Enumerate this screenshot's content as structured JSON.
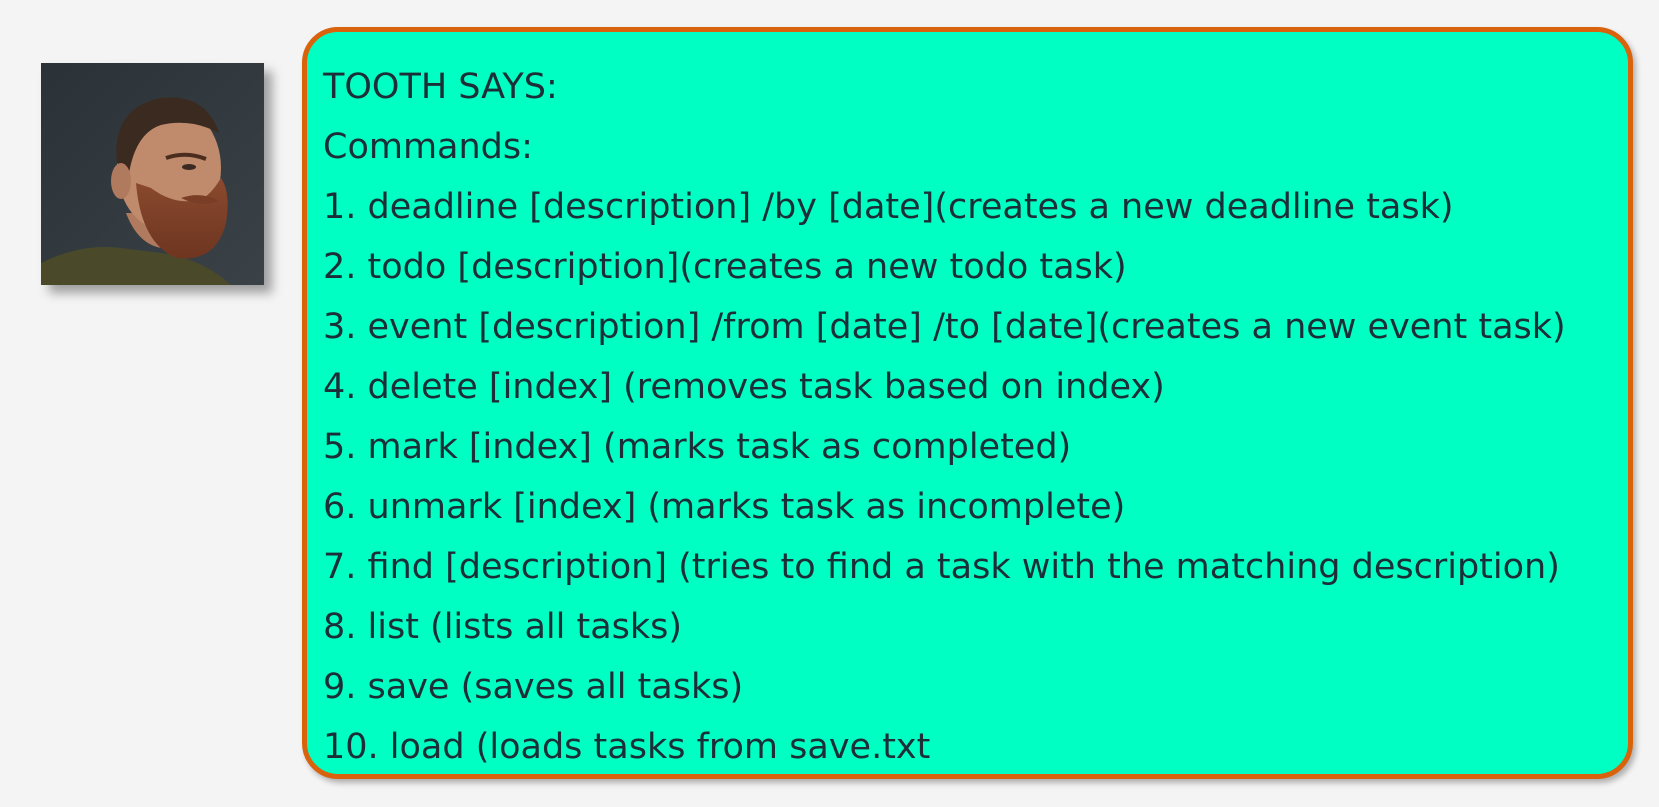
{
  "avatar": {
    "icon": "bearded-man-avatar",
    "alt": ""
  },
  "message": {
    "lines": [
      "TOOTH SAYS:",
      "Commands:",
      "1. deadline [description] /by [date](creates a new deadline task)",
      "2. todo [description](creates a new todo task)",
      "3. event [description] /from [date] /to [date](creates a new event task)",
      "4. delete [index] (removes task based on index)",
      "5. mark [index] (marks task as completed)",
      "6. unmark [index] (marks task as incomplete)",
      "7. find [description] (tries to find a task with the matching description)",
      "8. list (lists all tasks)",
      "9. save (saves all tasks)",
      "10. load (loads tasks from save.txt"
    ]
  },
  "colors": {
    "background": "#f4f4f4",
    "bubble_fill": "#00ffc2",
    "bubble_border": "#d9620c",
    "text": "#1c2e38"
  }
}
